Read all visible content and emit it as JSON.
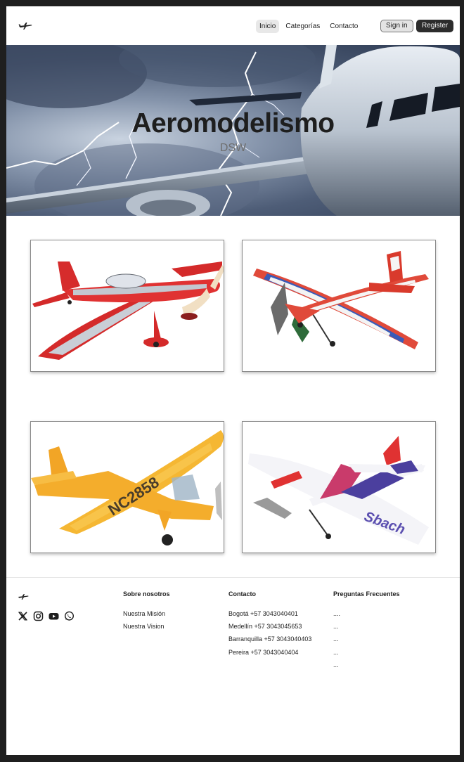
{
  "header": {
    "nav": [
      "Inicio",
      "Categorías",
      "Contacto"
    ],
    "signin_label": "Sign in",
    "register_label": "Register"
  },
  "hero": {
    "title": "Aeromodelismo",
    "subtitle": "DSW"
  },
  "footer": {
    "about": {
      "title": "Sobre nosotros",
      "items": [
        "Nuestra Misión",
        "Nuestra Vision"
      ]
    },
    "contact": {
      "title": "Contacto",
      "items": [
        "Bogotá +57 3043040401",
        "Medellín +57 3043045653",
        "Barranquilla +57 3043040403",
        "Pereira +57 3043040404"
      ]
    },
    "faq": {
      "title": "Preguntas Frecuentes",
      "items": [
        "....",
        "...",
        "...",
        "...",
        "..."
      ]
    }
  },
  "colors": {
    "accent_dark": "#2c2c2c",
    "active_nav_bg": "#e8e8e8"
  },
  "icons": [
    "airplane-logo-icon",
    "x-icon",
    "instagram-icon",
    "youtube-icon",
    "whatsapp-icon"
  ]
}
